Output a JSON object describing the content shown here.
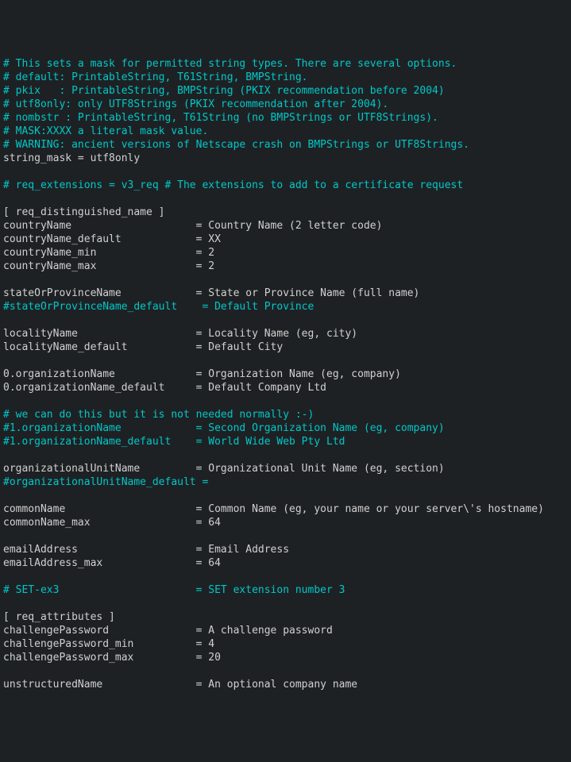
{
  "lines": [
    {
      "type": "cmt",
      "text": "# This sets a mask for permitted string types. There are several options."
    },
    {
      "type": "cmt",
      "text": "# default: PrintableString, T61String, BMPString."
    },
    {
      "type": "cmt",
      "text": "# pkix   : PrintableString, BMPString (PKIX recommendation before 2004)"
    },
    {
      "type": "cmt",
      "text": "# utf8only: only UTF8Strings (PKIX recommendation after 2004)."
    },
    {
      "type": "cmt",
      "text": "# nombstr : PrintableString, T61String (no BMPStrings or UTF8Strings)."
    },
    {
      "type": "cmt",
      "text": "# MASK:XXXX a literal mask value."
    },
    {
      "type": "cmt",
      "text": "# WARNING: ancient versions of Netscape crash on BMPStrings or UTF8Strings."
    },
    {
      "type": "txt",
      "text": "string_mask = utf8only"
    },
    {
      "type": "txt",
      "text": ""
    },
    {
      "type": "cmt",
      "text": "# req_extensions = v3_req # The extensions to add to a certificate request"
    },
    {
      "type": "txt",
      "text": ""
    },
    {
      "type": "txt",
      "text": "[ req_distinguished_name ]"
    },
    {
      "type": "txt",
      "text": "countryName                    = Country Name (2 letter code)"
    },
    {
      "type": "txt",
      "text": "countryName_default            = XX"
    },
    {
      "type": "txt",
      "text": "countryName_min                = 2"
    },
    {
      "type": "txt",
      "text": "countryName_max                = 2"
    },
    {
      "type": "txt",
      "text": ""
    },
    {
      "type": "txt",
      "text": "stateOrProvinceName            = State or Province Name (full name)"
    },
    {
      "type": "cmt",
      "text": "#stateOrProvinceName_default    = Default Province"
    },
    {
      "type": "txt",
      "text": ""
    },
    {
      "type": "txt",
      "text": "localityName                   = Locality Name (eg, city)"
    },
    {
      "type": "txt",
      "text": "localityName_default           = Default City"
    },
    {
      "type": "txt",
      "text": ""
    },
    {
      "type": "txt",
      "text": "0.organizationName             = Organization Name (eg, company)"
    },
    {
      "type": "txt",
      "text": "0.organizationName_default     = Default Company Ltd"
    },
    {
      "type": "txt",
      "text": ""
    },
    {
      "type": "cmt",
      "text": "# we can do this but it is not needed normally :-)"
    },
    {
      "type": "cmt",
      "text": "#1.organizationName            = Second Organization Name (eg, company)"
    },
    {
      "type": "cmt",
      "text": "#1.organizationName_default    = World Wide Web Pty Ltd"
    },
    {
      "type": "txt",
      "text": ""
    },
    {
      "type": "txt",
      "text": "organizationalUnitName         = Organizational Unit Name (eg, section)"
    },
    {
      "type": "cmt",
      "text": "#organizationalUnitName_default ="
    },
    {
      "type": "txt",
      "text": ""
    },
    {
      "type": "txt",
      "text": "commonName                     = Common Name (eg, your name or your server\\'s hostname)"
    },
    {
      "type": "txt",
      "text": "commonName_max                 = 64"
    },
    {
      "type": "txt",
      "text": ""
    },
    {
      "type": "txt",
      "text": "emailAddress                   = Email Address"
    },
    {
      "type": "txt",
      "text": "emailAddress_max               = 64"
    },
    {
      "type": "txt",
      "text": ""
    },
    {
      "type": "cmt",
      "text": "# SET-ex3                      = SET extension number 3"
    },
    {
      "type": "txt",
      "text": ""
    },
    {
      "type": "txt",
      "text": "[ req_attributes ]"
    },
    {
      "type": "txt",
      "text": "challengePassword              = A challenge password"
    },
    {
      "type": "txt",
      "text": "challengePassword_min          = 4"
    },
    {
      "type": "txt",
      "text": "challengePassword_max          = 20"
    },
    {
      "type": "txt",
      "text": ""
    },
    {
      "type": "txt",
      "text": "unstructuredName               = An optional company name"
    }
  ]
}
